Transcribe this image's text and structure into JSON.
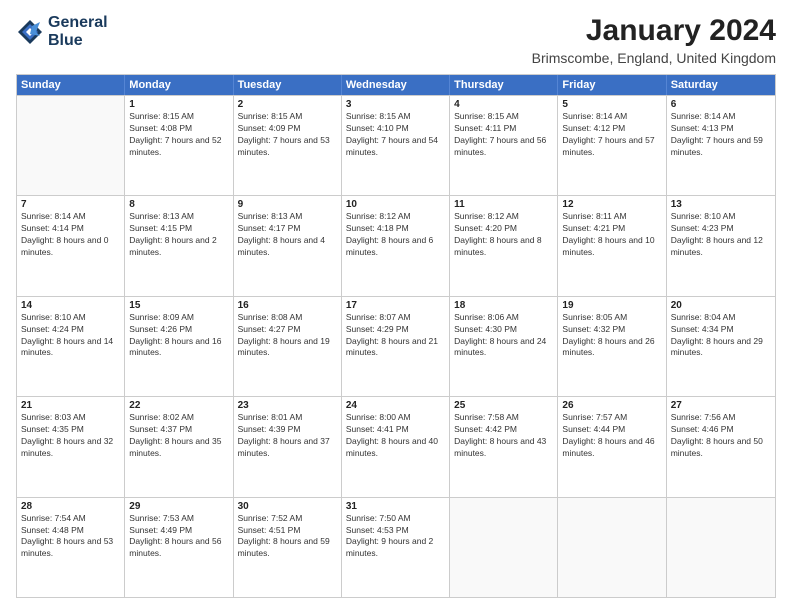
{
  "logo": {
    "line1": "General",
    "line2": "Blue"
  },
  "title": "January 2024",
  "subtitle": "Brimscombe, England, United Kingdom",
  "days_of_week": [
    "Sunday",
    "Monday",
    "Tuesday",
    "Wednesday",
    "Thursday",
    "Friday",
    "Saturday"
  ],
  "weeks": [
    [
      {
        "day": "",
        "sunrise": "",
        "sunset": "",
        "daylight": ""
      },
      {
        "day": "1",
        "sunrise": "Sunrise: 8:15 AM",
        "sunset": "Sunset: 4:08 PM",
        "daylight": "Daylight: 7 hours and 52 minutes."
      },
      {
        "day": "2",
        "sunrise": "Sunrise: 8:15 AM",
        "sunset": "Sunset: 4:09 PM",
        "daylight": "Daylight: 7 hours and 53 minutes."
      },
      {
        "day": "3",
        "sunrise": "Sunrise: 8:15 AM",
        "sunset": "Sunset: 4:10 PM",
        "daylight": "Daylight: 7 hours and 54 minutes."
      },
      {
        "day": "4",
        "sunrise": "Sunrise: 8:15 AM",
        "sunset": "Sunset: 4:11 PM",
        "daylight": "Daylight: 7 hours and 56 minutes."
      },
      {
        "day": "5",
        "sunrise": "Sunrise: 8:14 AM",
        "sunset": "Sunset: 4:12 PM",
        "daylight": "Daylight: 7 hours and 57 minutes."
      },
      {
        "day": "6",
        "sunrise": "Sunrise: 8:14 AM",
        "sunset": "Sunset: 4:13 PM",
        "daylight": "Daylight: 7 hours and 59 minutes."
      }
    ],
    [
      {
        "day": "7",
        "sunrise": "Sunrise: 8:14 AM",
        "sunset": "Sunset: 4:14 PM",
        "daylight": "Daylight: 8 hours and 0 minutes."
      },
      {
        "day": "8",
        "sunrise": "Sunrise: 8:13 AM",
        "sunset": "Sunset: 4:15 PM",
        "daylight": "Daylight: 8 hours and 2 minutes."
      },
      {
        "day": "9",
        "sunrise": "Sunrise: 8:13 AM",
        "sunset": "Sunset: 4:17 PM",
        "daylight": "Daylight: 8 hours and 4 minutes."
      },
      {
        "day": "10",
        "sunrise": "Sunrise: 8:12 AM",
        "sunset": "Sunset: 4:18 PM",
        "daylight": "Daylight: 8 hours and 6 minutes."
      },
      {
        "day": "11",
        "sunrise": "Sunrise: 8:12 AM",
        "sunset": "Sunset: 4:20 PM",
        "daylight": "Daylight: 8 hours and 8 minutes."
      },
      {
        "day": "12",
        "sunrise": "Sunrise: 8:11 AM",
        "sunset": "Sunset: 4:21 PM",
        "daylight": "Daylight: 8 hours and 10 minutes."
      },
      {
        "day": "13",
        "sunrise": "Sunrise: 8:10 AM",
        "sunset": "Sunset: 4:23 PM",
        "daylight": "Daylight: 8 hours and 12 minutes."
      }
    ],
    [
      {
        "day": "14",
        "sunrise": "Sunrise: 8:10 AM",
        "sunset": "Sunset: 4:24 PM",
        "daylight": "Daylight: 8 hours and 14 minutes."
      },
      {
        "day": "15",
        "sunrise": "Sunrise: 8:09 AM",
        "sunset": "Sunset: 4:26 PM",
        "daylight": "Daylight: 8 hours and 16 minutes."
      },
      {
        "day": "16",
        "sunrise": "Sunrise: 8:08 AM",
        "sunset": "Sunset: 4:27 PM",
        "daylight": "Daylight: 8 hours and 19 minutes."
      },
      {
        "day": "17",
        "sunrise": "Sunrise: 8:07 AM",
        "sunset": "Sunset: 4:29 PM",
        "daylight": "Daylight: 8 hours and 21 minutes."
      },
      {
        "day": "18",
        "sunrise": "Sunrise: 8:06 AM",
        "sunset": "Sunset: 4:30 PM",
        "daylight": "Daylight: 8 hours and 24 minutes."
      },
      {
        "day": "19",
        "sunrise": "Sunrise: 8:05 AM",
        "sunset": "Sunset: 4:32 PM",
        "daylight": "Daylight: 8 hours and 26 minutes."
      },
      {
        "day": "20",
        "sunrise": "Sunrise: 8:04 AM",
        "sunset": "Sunset: 4:34 PM",
        "daylight": "Daylight: 8 hours and 29 minutes."
      }
    ],
    [
      {
        "day": "21",
        "sunrise": "Sunrise: 8:03 AM",
        "sunset": "Sunset: 4:35 PM",
        "daylight": "Daylight: 8 hours and 32 minutes."
      },
      {
        "day": "22",
        "sunrise": "Sunrise: 8:02 AM",
        "sunset": "Sunset: 4:37 PM",
        "daylight": "Daylight: 8 hours and 35 minutes."
      },
      {
        "day": "23",
        "sunrise": "Sunrise: 8:01 AM",
        "sunset": "Sunset: 4:39 PM",
        "daylight": "Daylight: 8 hours and 37 minutes."
      },
      {
        "day": "24",
        "sunrise": "Sunrise: 8:00 AM",
        "sunset": "Sunset: 4:41 PM",
        "daylight": "Daylight: 8 hours and 40 minutes."
      },
      {
        "day": "25",
        "sunrise": "Sunrise: 7:58 AM",
        "sunset": "Sunset: 4:42 PM",
        "daylight": "Daylight: 8 hours and 43 minutes."
      },
      {
        "day": "26",
        "sunrise": "Sunrise: 7:57 AM",
        "sunset": "Sunset: 4:44 PM",
        "daylight": "Daylight: 8 hours and 46 minutes."
      },
      {
        "day": "27",
        "sunrise": "Sunrise: 7:56 AM",
        "sunset": "Sunset: 4:46 PM",
        "daylight": "Daylight: 8 hours and 50 minutes."
      }
    ],
    [
      {
        "day": "28",
        "sunrise": "Sunrise: 7:54 AM",
        "sunset": "Sunset: 4:48 PM",
        "daylight": "Daylight: 8 hours and 53 minutes."
      },
      {
        "day": "29",
        "sunrise": "Sunrise: 7:53 AM",
        "sunset": "Sunset: 4:49 PM",
        "daylight": "Daylight: 8 hours and 56 minutes."
      },
      {
        "day": "30",
        "sunrise": "Sunrise: 7:52 AM",
        "sunset": "Sunset: 4:51 PM",
        "daylight": "Daylight: 8 hours and 59 minutes."
      },
      {
        "day": "31",
        "sunrise": "Sunrise: 7:50 AM",
        "sunset": "Sunset: 4:53 PM",
        "daylight": "Daylight: 9 hours and 2 minutes."
      },
      {
        "day": "",
        "sunrise": "",
        "sunset": "",
        "daylight": ""
      },
      {
        "day": "",
        "sunrise": "",
        "sunset": "",
        "daylight": ""
      },
      {
        "day": "",
        "sunrise": "",
        "sunset": "",
        "daylight": ""
      }
    ]
  ]
}
